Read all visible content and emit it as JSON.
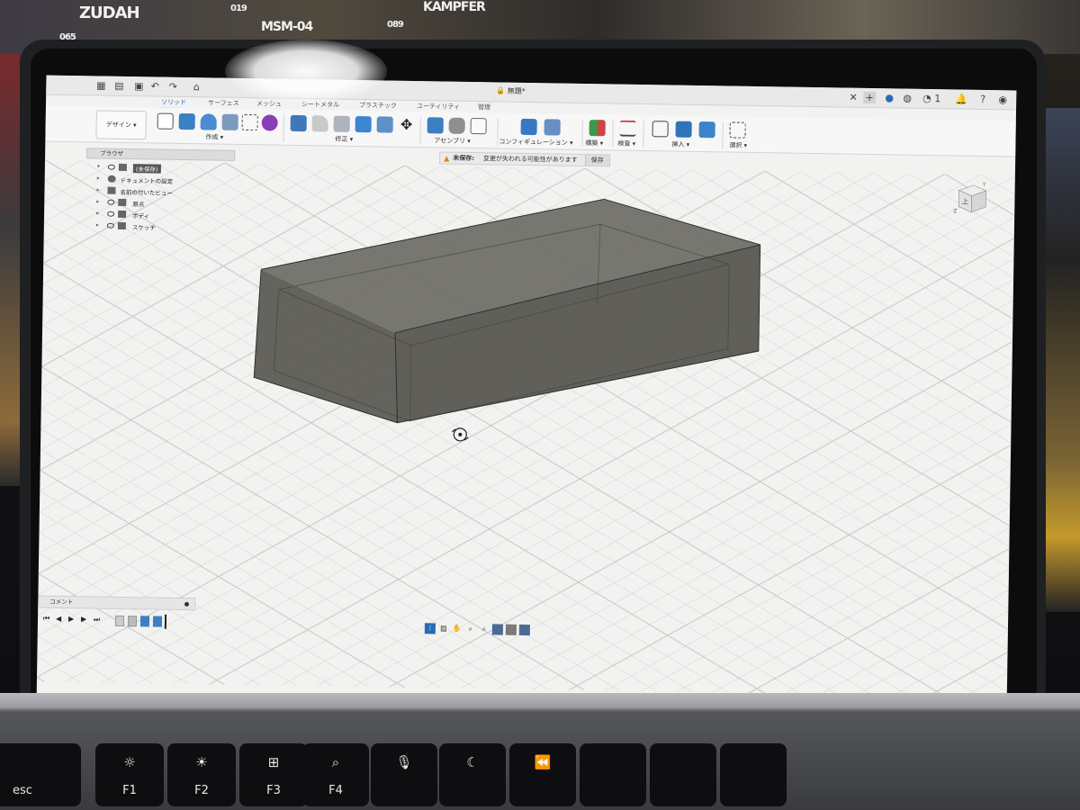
{
  "background": {
    "box_labels": [
      "ZUDAH",
      "MSM-04",
      "KAMPFER"
    ],
    "box_numbers": [
      "065",
      "019",
      "089"
    ]
  },
  "app": {
    "doc_title": "無題*",
    "notification_count": "1",
    "design_button": "デザイン",
    "ribbon_tabs": [
      {
        "label": "ソリッド",
        "active": true
      },
      {
        "label": "サーフェス",
        "active": false
      },
      {
        "label": "メッシュ",
        "active": false
      },
      {
        "label": "シートメタル",
        "active": false
      },
      {
        "label": "プラスチック",
        "active": false
      },
      {
        "label": "ユーティリティ",
        "active": false
      },
      {
        "label": "管理",
        "active": false
      }
    ],
    "groups": {
      "create": "作成",
      "modify": "修正",
      "assemble": "アセンブリ",
      "configure": "コンフィギュレーション",
      "construct": "構築",
      "inspect": "検査",
      "insert": "挿入",
      "select": "選択"
    },
    "warning": {
      "label": "未保存:",
      "message": "変更が失われる可能性があります",
      "save": "保存"
    },
    "browser": {
      "header": "ブラウザ",
      "items": [
        {
          "label": "(未保存)"
        },
        {
          "label": "ドキュメントの設定"
        },
        {
          "label": "名前の付いたビュー"
        },
        {
          "label": "原点"
        },
        {
          "label": "ボディ"
        },
        {
          "label": "スケッチ"
        }
      ]
    },
    "comment_bar": "コメント",
    "viewcube": {
      "face_label": "上",
      "axis_x": "X",
      "axis_y": "Y",
      "axis_z": "Z"
    }
  },
  "keyboard": {
    "keys": [
      {
        "label": "esc",
        "glyph": ""
      },
      {
        "label": "F1",
        "glyph": "☼"
      },
      {
        "label": "F2",
        "glyph": "☀"
      },
      {
        "label": "F3",
        "glyph": "⊞"
      },
      {
        "label": "F4",
        "glyph": "⌕"
      },
      {
        "label": "",
        "glyph": "🎙"
      },
      {
        "label": "",
        "glyph": "☾"
      },
      {
        "label": "",
        "glyph": "⏪"
      }
    ]
  },
  "colors": {
    "accent": "#2a6bb5",
    "box_fill": "#5f5e57",
    "grid": "#dadad8"
  }
}
